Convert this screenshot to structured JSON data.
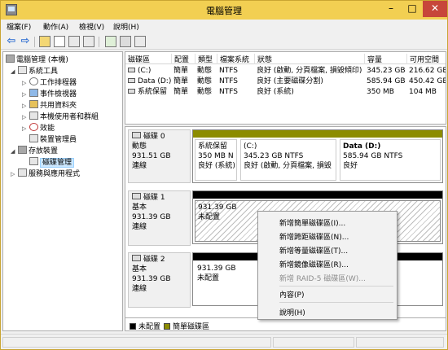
{
  "window": {
    "title": "電腦管理"
  },
  "menu": [
    "檔案(F)",
    "動作(A)",
    "檢視(V)",
    "說明(H)"
  ],
  "tree": [
    {
      "label": "電腦管理 (本機)",
      "icon": "computer-management-icon"
    },
    {
      "label": "系統工具",
      "icon": "tools-icon"
    },
    {
      "label": "工作排程器",
      "icon": "clock-icon"
    },
    {
      "label": "事件檢視器",
      "icon": "event-viewer-icon"
    },
    {
      "label": "共用資料夾",
      "icon": "shared-folder-icon"
    },
    {
      "label": "本機使用者和群組",
      "icon": "users-icon"
    },
    {
      "label": "效能",
      "icon": "performance-icon"
    },
    {
      "label": "裝置管理員",
      "icon": "device-manager-icon"
    },
    {
      "label": "存放裝置",
      "icon": "storage-icon"
    },
    {
      "label": "磁碟管理",
      "icon": "disk-management-icon"
    },
    {
      "label": "服務與應用程式",
      "icon": "services-icon"
    }
  ],
  "volume_table": {
    "columns": [
      "磁碟區",
      "配置",
      "類型",
      "檔案系統",
      "狀態",
      "容量",
      "可用空間"
    ],
    "rows": [
      [
        "(C:)",
        "簡單",
        "動態",
        "NTFS",
        "良好 (啟動, 分頁檔案, 損毀傾印)",
        "345.23 GB",
        "216.62 GB"
      ],
      [
        "Data (D:)",
        "簡單",
        "動態",
        "NTFS",
        "良好 (主要磁碟分割)",
        "585.94 GB",
        "450.42 GB"
      ],
      [
        "系統保留",
        "簡單",
        "動態",
        "NTFS",
        "良好 (系統)",
        "350 MB",
        "104 MB"
      ]
    ]
  },
  "disks": [
    {
      "name": "磁碟 0",
      "type": "動態",
      "size": "931.51 GB",
      "status": "連線",
      "partitions": [
        {
          "name": "系統保留",
          "detail": "350 MB N",
          "status": "良好 (系統)"
        },
        {
          "name": "(C:)",
          "detail": "345.23 GB NTFS",
          "status": "良好 (啟動, 分頁檔案, 損毀"
        },
        {
          "name": "Data (D:)",
          "detail": "585.94 GB NTFS",
          "status": "良好"
        }
      ]
    },
    {
      "name": "磁碟 1",
      "type": "基本",
      "size": "931.39 GB",
      "status": "連線",
      "partitions": [
        {
          "size": "931.39 GB",
          "label": "未配置"
        }
      ]
    },
    {
      "name": "磁碟 2",
      "type": "基本",
      "size": "931.39 GB",
      "status": "連線",
      "partitions": [
        {
          "size": "931.39 GB",
          "label": "未配置"
        }
      ]
    }
  ],
  "legend": [
    {
      "label": "未配置",
      "color": "#000000"
    },
    {
      "label": "簡單磁碟區",
      "color": "#8c8c00"
    }
  ],
  "context_menu": {
    "items": [
      {
        "label": "新增簡單磁碟區(I)...",
        "disabled": false
      },
      {
        "label": "新增跨距磁碟區(N)...",
        "disabled": false
      },
      {
        "label": "新增等量磁碟區(T)...",
        "disabled": false
      },
      {
        "label": "新增鏡像磁碟區(R)...",
        "disabled": false
      },
      {
        "label": "新增 RAID-5 磁碟區(W)...",
        "disabled": true
      },
      {
        "label": "內容(P)",
        "disabled": false
      },
      {
        "label": "說明(H)",
        "disabled": false
      }
    ]
  }
}
